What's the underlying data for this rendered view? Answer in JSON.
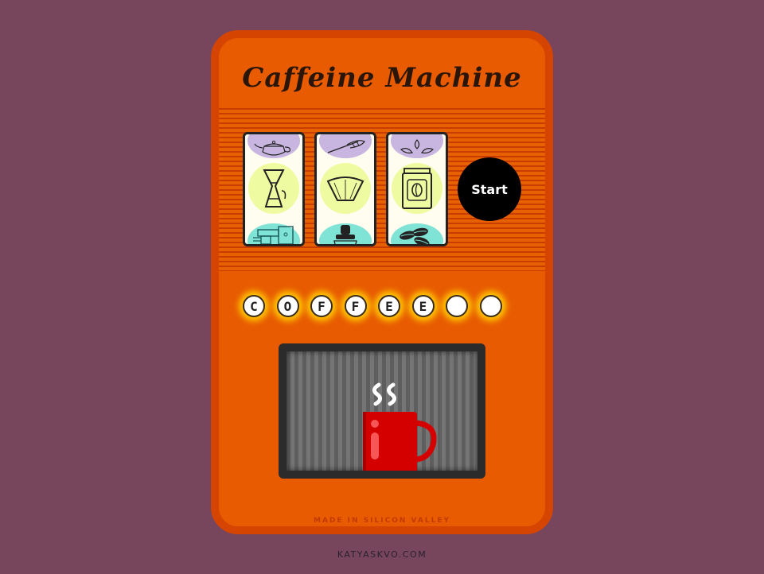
{
  "app": {
    "title": "Caffeine Machine",
    "start_label": "Start",
    "made_in": "MADE IN SILICON VALLEY",
    "footer": "KATYASKVO.COM"
  },
  "reels": [
    {
      "top_icon": "teapot-icon",
      "middle_icon": "chemex-icon",
      "bottom_icon": "espresso-machine-icon"
    },
    {
      "top_icon": "whisk-icon",
      "middle_icon": "coffee-filter-icon",
      "bottom_icon": "tamper-icon"
    },
    {
      "top_icon": "coffee-plant-icon",
      "middle_icon": "coffee-jar-icon",
      "bottom_icon": "coffee-beans-icon"
    }
  ],
  "letters": [
    "C",
    "O",
    "F",
    "F",
    "E",
    "E",
    "",
    ""
  ],
  "colors": {
    "background": "#77465c",
    "machine": "#e85b00",
    "machine_border": "#d54400",
    "start_button": "#000000",
    "mug": "#d40000",
    "letter_glow": "#ffc800"
  },
  "icons": {
    "steam": "steam-icon",
    "mug": "mug-icon"
  }
}
